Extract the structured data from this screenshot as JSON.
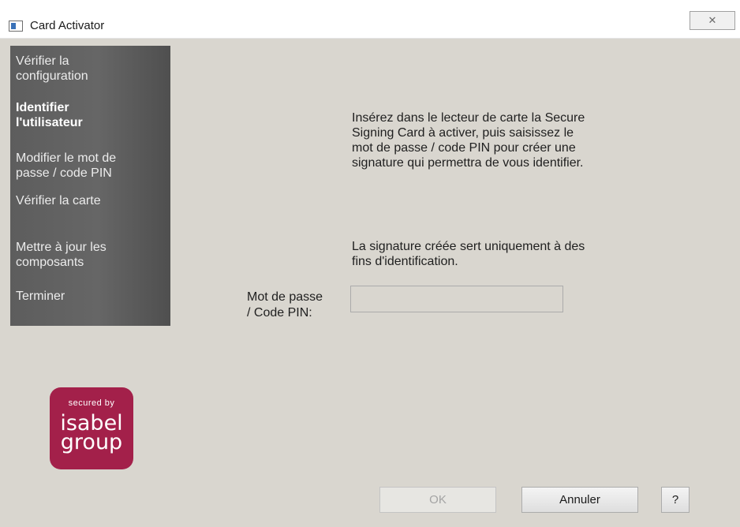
{
  "window": {
    "title": "Card Activator",
    "close_glyph": "✕"
  },
  "sidebar": {
    "items": [
      {
        "label_line1": "Vérifier la",
        "label_line2": "configuration",
        "active": false
      },
      {
        "label_line1": "Identifier",
        "label_line2": "l'utilisateur",
        "active": true
      },
      {
        "label_line1": "Modifier le mot de",
        "label_line2": "passe / code PIN",
        "active": false
      },
      {
        "label_line1": "Vérifier la carte",
        "label_line2": "",
        "active": false
      },
      {
        "label_line1": "Mettre à jour les",
        "label_line2": "composants",
        "active": false
      },
      {
        "label_line1": "Terminer",
        "label_line2": "",
        "active": false
      }
    ]
  },
  "main": {
    "instruction_lines": [
      "Insérez dans le lecteur de carte la Secure",
      "Signing Card à activer, puis saisissez le",
      "mot de passe / code PIN pour créer une",
      "signature qui permettra de vous identifier."
    ],
    "note_lines": [
      "La signature créée sert uniquement à des",
      "fins d'identification."
    ],
    "pin_label_line1": "Mot de passe",
    "pin_label_line2": "/ Code PIN:",
    "pin_value": ""
  },
  "logo": {
    "small_text": "secured by",
    "line1": "isabel",
    "line2": "group",
    "color": "#a3204a"
  },
  "buttons": {
    "ok_label": "OK",
    "cancel_label": "Annuler",
    "help_label": "?"
  }
}
